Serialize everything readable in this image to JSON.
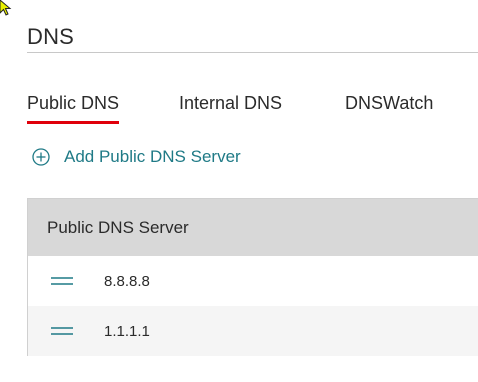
{
  "page": {
    "title": "DNS"
  },
  "tabs": [
    {
      "label": "Public DNS",
      "active": true
    },
    {
      "label": "Internal DNS",
      "active": false
    },
    {
      "label": "DNSWatch",
      "active": false
    }
  ],
  "add_action": {
    "label": "Add Public DNS Server",
    "icon": "plus-circle-icon"
  },
  "table": {
    "header": "Public DNS Server",
    "rows": [
      {
        "value": "8.8.8.8",
        "icon": "drag-handle-icon"
      },
      {
        "value": "1.1.1.1",
        "icon": "drag-handle-icon"
      }
    ]
  },
  "colors": {
    "accent": "#1f7a86",
    "active_tab_underline": "#e0000b",
    "header_bg": "#d8d8d8",
    "cursor": "#e8f000"
  }
}
